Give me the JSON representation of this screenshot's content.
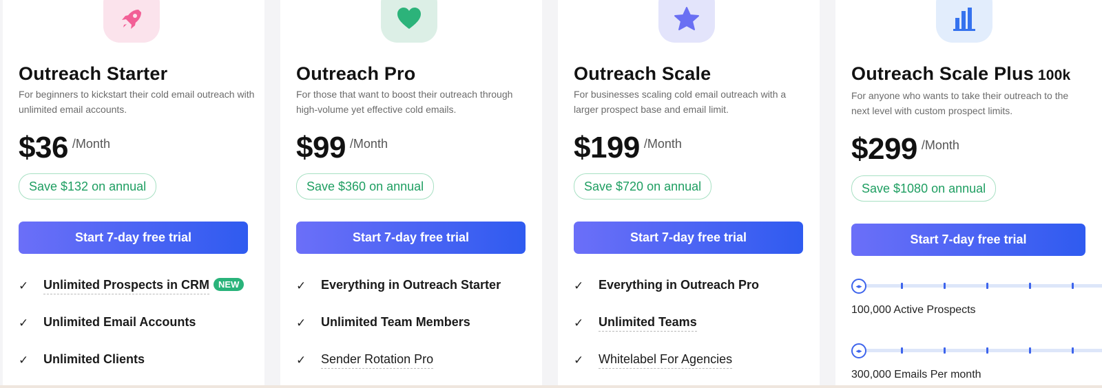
{
  "plans": [
    {
      "title": "Outreach Starter",
      "title_extra": "",
      "description": "For beginners to kickstart their cold email outreach with unlimited email accounts.",
      "price": "$36",
      "period": "/Month",
      "save": "Save $132 on annual",
      "cta": "Start 7-day free trial",
      "icon": "rocket-icon",
      "icon_bg": "#fbe3ec",
      "icon_color": "#f25f96",
      "features": [
        {
          "label": "Unlimited Prospects in CRM",
          "badge": "NEW"
        },
        {
          "label": "Unlimited Email Accounts"
        },
        {
          "label": "Unlimited Clients"
        }
      ]
    },
    {
      "title": "Outreach Pro",
      "title_extra": "",
      "description": "For those that want to boost their outreach through high-volume yet effective cold emails.",
      "price": "$99",
      "period": "/Month",
      "save": "Save $360 on annual",
      "cta": "Start 7-day free trial",
      "icon": "heart-icon",
      "icon_bg": "#dcefe6",
      "icon_color": "#2cb37a",
      "features": [
        {
          "label": "Everything in Outreach Starter"
        },
        {
          "label": "Unlimited Team Members"
        },
        {
          "label": "Sender Rotation Pro"
        }
      ]
    },
    {
      "title": "Outreach Scale",
      "title_extra": "",
      "description": "For businesses scaling cold email outreach with a larger prospect base and email limit.",
      "price": "$199",
      "period": "/Month",
      "save": "Save $720 on annual",
      "cta": "Start 7-day free trial",
      "icon": "star-icon",
      "icon_bg": "#e3e4fb",
      "icon_color": "#6a6ff3",
      "features": [
        {
          "label": "Everything in Outreach Pro"
        },
        {
          "label": "Unlimited Teams"
        },
        {
          "label": "Whitelabel For Agencies"
        }
      ]
    },
    {
      "title": "Outreach Scale Plus",
      "title_extra": "100k",
      "description": "For anyone who wants to take their outreach to the next level with custom prospect limits.",
      "price": "$299",
      "period": "/Month",
      "save": "Save $1080 on annual",
      "cta": "Start 7-day free trial",
      "icon": "bar-chart-icon",
      "icon_bg": "#e2edfc",
      "icon_color": "#3572ee",
      "sliders": [
        {
          "label": "100,000 Active Prospects",
          "level": 0
        },
        {
          "label": "300,000 Emails Per month",
          "level": 0
        }
      ]
    }
  ],
  "colors": {
    "accent": "#3d64ec",
    "save_green": "#1e9e61",
    "badge_green": "#29b37a"
  }
}
